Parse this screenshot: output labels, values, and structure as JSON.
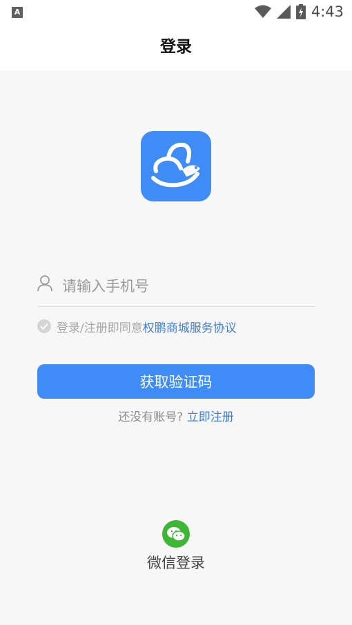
{
  "status_bar": {
    "notification_icon": "A",
    "time": "4:43",
    "icons": [
      "wifi-icon",
      "signal-icon",
      "battery-charging-icon"
    ]
  },
  "header": {
    "title": "登录"
  },
  "logo": {
    "icon": "app-logo-icon",
    "color": "#3f8cf6"
  },
  "phone_field": {
    "icon": "user-icon",
    "placeholder": "请输入手机号",
    "value": ""
  },
  "agreement": {
    "text": "登录/注册即同意",
    "link": "权鹏商城服务协议",
    "checked": false
  },
  "primary_button": {
    "label": "获取验证码",
    "color": "#3f8cf6"
  },
  "register": {
    "prompt": "还没有账号?",
    "link": "立即注册"
  },
  "wechat_login": {
    "icon": "wechat-icon",
    "label": "微信登录",
    "color": "#3fb736"
  }
}
